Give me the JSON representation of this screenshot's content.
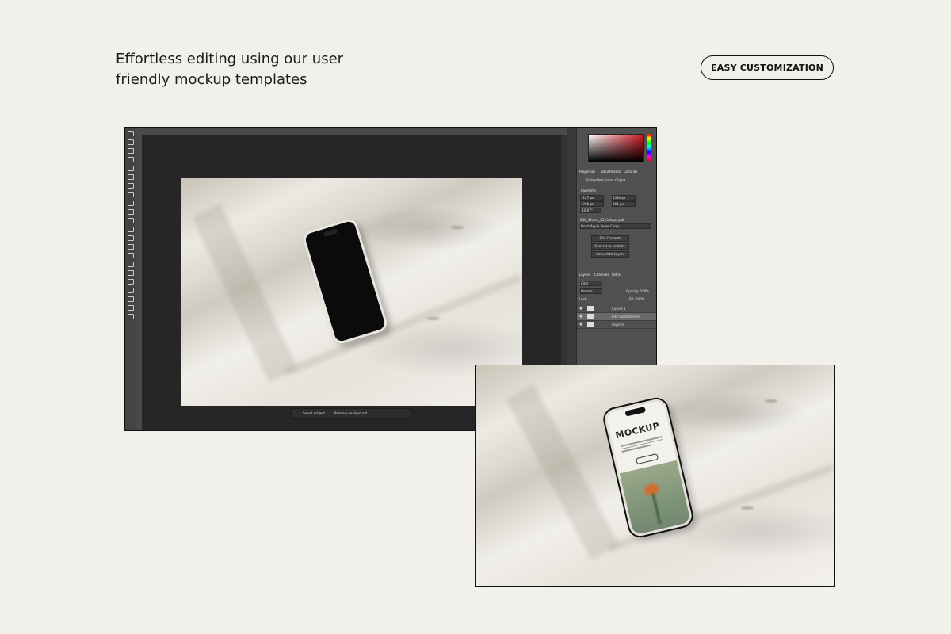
{
  "headline": {
    "line1": "Effortless editing using our user",
    "line2": "friendly mockup templates"
  },
  "badge": {
    "label": "EASY CUSTOMIZATION"
  },
  "photoshop": {
    "properties_tabs": [
      "Properties",
      "Adjustments",
      "Libraries"
    ],
    "smart_object_label": "Embedded Smart Object",
    "transform_label": "Transform",
    "fields": {
      "w": "1127 px",
      "h": "1594 px",
      "x": "1766 px",
      "y": "805 px",
      "angle": "-16.67°"
    },
    "filename": "Edit_iPhone_03_Sofa.ps.psb",
    "layer_comp_placeholder": "Don't Apply Layer Comp",
    "buttons": [
      "Edit Contents",
      "Convert to Linked...",
      "Convert to Layers"
    ],
    "layers_tabs": [
      "Layers",
      "Channels",
      "Paths"
    ],
    "filter_kind": "Kind",
    "blend_mode": "Normal",
    "opacity": "Opacity: 100%",
    "lock_label": "Lock:",
    "fill": "Fill: 100%",
    "layers": [
      "Curves 1",
      "Edit Content Here",
      "Layer 0"
    ],
    "context_bar": [
      "Select subject",
      "Remove background"
    ]
  },
  "mockup_screen": {
    "brand": "MOCKUP"
  },
  "colors": {
    "background": "#f2f0eb",
    "ps_dark": "#3b3b3b",
    "accent_red": "#d31b25"
  }
}
